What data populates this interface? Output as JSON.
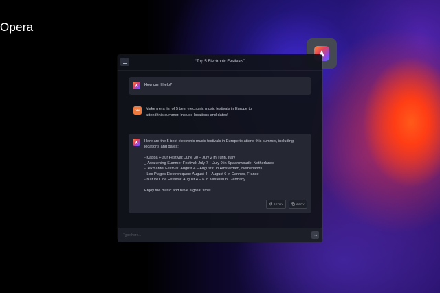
{
  "brand": {
    "name": "Opera"
  },
  "chat": {
    "title": "“Top 5 Electronic Festivals”",
    "greeting": "How can I help?",
    "user_avatar": "YM",
    "user_message": "Make me a list of 5 best electronic music festivals in Europe to attend this summer. Include locations and dates!",
    "reply_intro": "Here are the 5 best electronic music festivals in Europe to attend this summer, including locations and dates:",
    "festivals": [
      "- Kappa Futur Festival: June 30 – July 2 in Turin, Italy",
      "_ Awakening Summer Festival: July 7 – July 9 in Spaarnwoude, Netherlands",
      "-Dekmantel Festival: August 4 – August 6 in Amsterdam, Netherlands",
      "- Les Plages Électroniques: August 4 – August 6 in Cannes, France",
      "- Nature One Festival: August 4 – 6 in Kastellaun, Germany"
    ],
    "reply_outro": "Enjoy the music and have a great time!",
    "retry_label": "RETRY",
    "copy_label": "COPY",
    "input_placeholder": "Type here...",
    "icons": {
      "menu": "menu-icon",
      "logo": "aria-logo-icon",
      "retry": "retry-icon",
      "copy": "copy-icon",
      "send": "send-icon"
    }
  }
}
